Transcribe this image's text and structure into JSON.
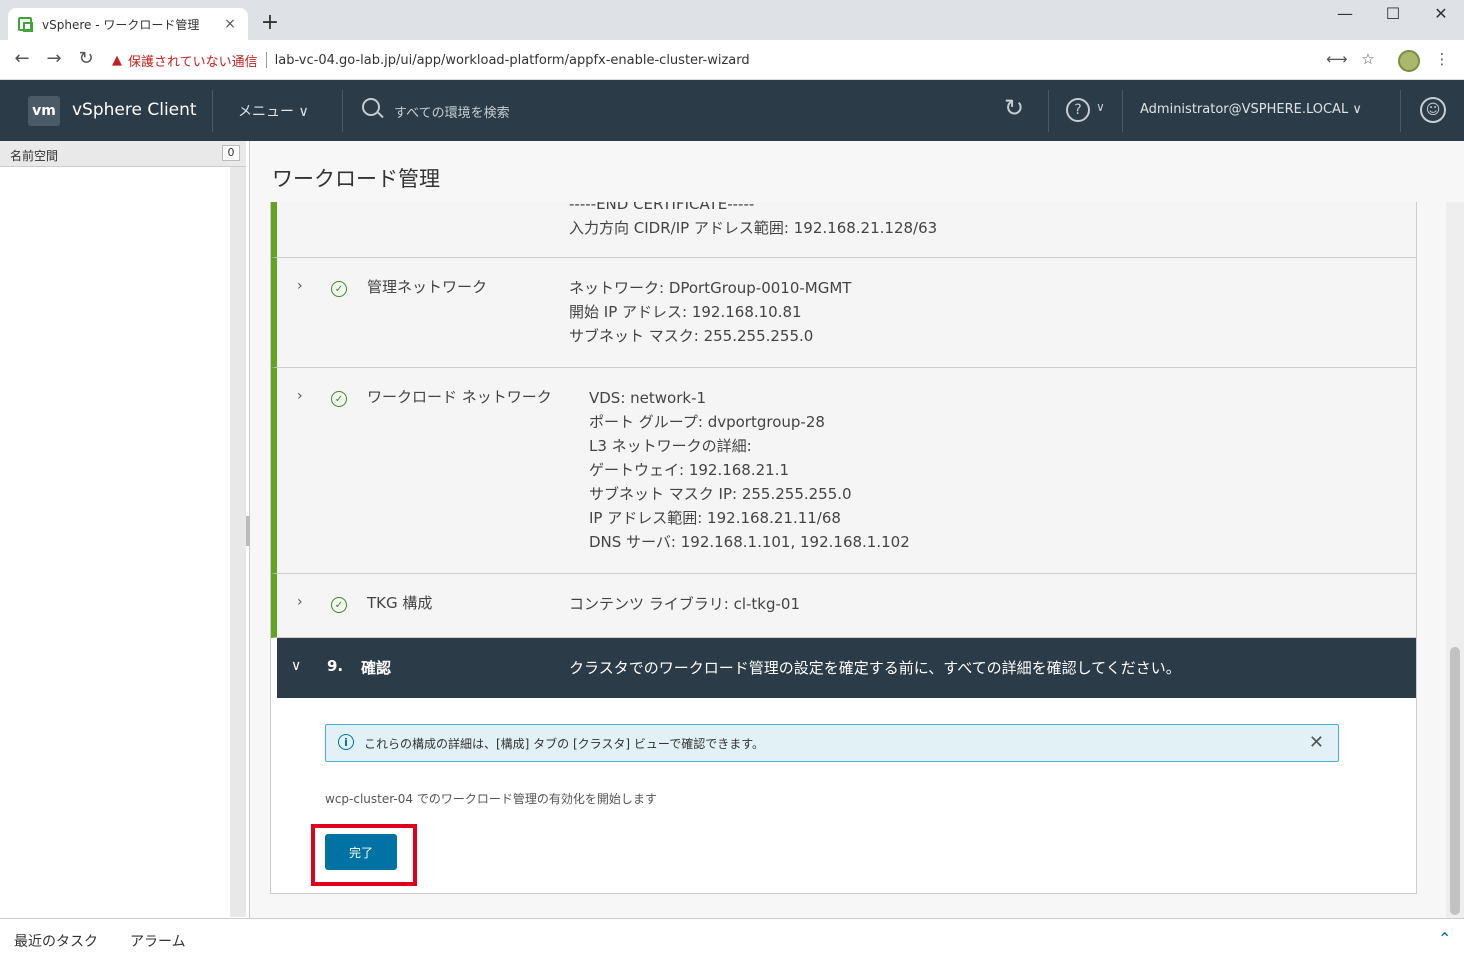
{
  "browser": {
    "tab_title": "vSphere - ワークロード管理",
    "tab_close": "×",
    "new_tab": "+",
    "window_controls": [
      "—",
      "☐",
      "✕"
    ],
    "back_icon": "←",
    "forward_icon": "→",
    "reload_icon": "↻",
    "security_warning": "保護されていない通信",
    "url": "lab-vc-04.go-lab.jp/ui/app/workload-platform/appfx-enable-cluster-wizard",
    "translate_icon": "⟷",
    "star_icon": "☆",
    "more_icon": "⋮"
  },
  "header": {
    "logo": "vm",
    "product": "vSphere Client",
    "menu": "メニュー ∨",
    "search_placeholder": "すべての環境を検索",
    "user": "Administrator@VSPHERE.LOCAL ∨",
    "help_icon": "?",
    "help_chevron": "∨",
    "refresh_icon": "↻",
    "smile_icon": "☺"
  },
  "left_pane": {
    "header": "名前空間",
    "count": "0"
  },
  "main": {
    "title": "ワークロード管理",
    "partial_row": {
      "lines": [
        "-----END CERTIFICATE-----",
        "入力方向 CIDR/IP アドレス範囲: 192.168.21.128/63"
      ]
    },
    "rows": [
      {
        "label": "管理ネットワーク",
        "details": [
          "ネットワーク: DPortGroup-0010-MGMT",
          "開始 IP アドレス: 192.168.10.81",
          "サブネット マスク: 255.255.255.0"
        ]
      },
      {
        "label": "ワークロード ネットワーク",
        "details": [
          "VDS: network-1",
          "ポート グループ: dvportgroup-28",
          "L3 ネットワークの詳細:",
          "ゲートウェイ: 192.168.21.1",
          "サブネット マスク IP: 255.255.255.0",
          "IP アドレス範囲: 192.168.21.11/68",
          "DNS サーバ: 192.168.1.101, 192.168.1.102"
        ]
      },
      {
        "label": "TKG 構成",
        "details": [
          "コンテンツ ライブラリ: cl-tkg-01"
        ]
      }
    ],
    "chevron_right": "›",
    "check_icon": "✓",
    "step": {
      "chevron": "∨",
      "number": "9.",
      "label": "確認",
      "description": "クラスタでのワークロード管理の設定を確定する前に、すべての詳細を確認してください。"
    },
    "info": {
      "icon": "i",
      "text": "これらの構成の詳細は、[構成] タブの [クラスタ] ビューで確認できます。",
      "close": "✕"
    },
    "enable_text": "wcp-cluster-04 でのワークロード管理の有効化を開始します",
    "finish_button": "完了"
  },
  "bottom": {
    "recent_tasks": "最近のタスク",
    "alarms": "アラーム",
    "expand_icon": "⌃"
  }
}
